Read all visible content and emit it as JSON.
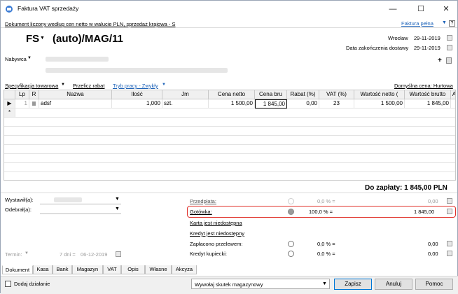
{
  "window": {
    "title": "Faktura VAT sprzedaży"
  },
  "info_bar": {
    "text": "Dokument liczony według cen netto w walucie PLN, sprzedaż krajowa - S",
    "link": "Faktura pełna"
  },
  "header": {
    "doc_type": "FS",
    "doc_number": "(auto)/MAG/11",
    "place": "Wrocław",
    "date": "29-11-2019",
    "delivery_label": "Data zakończenia dostawy",
    "delivery_date": "29-11-2019",
    "buyer_label": "Nabywca"
  },
  "toolbar": {
    "spec": "Specyfikacja towarowa",
    "recalc": "Przelicz rabat",
    "mode": "Tryb pracy - Zwykły",
    "default_price": "Domyślna cena: Hurtowa"
  },
  "grid": {
    "columns": [
      "Lp",
      "R",
      "Nazwa",
      "Ilość",
      "Jm",
      "Cena netto",
      "Cena bru",
      "Rabat (%)",
      "VAT (%)",
      "Wartość netto (",
      "Wartość brutto",
      "A"
    ],
    "rows": [
      {
        "lp": "1",
        "name": "adsf",
        "qty": "1,000",
        "unit": "szt.",
        "net": "1 500,00",
        "gross": "1 845,00",
        "discount": "0,00",
        "vat": "23",
        "net_value": "1 500,00",
        "gross_value": "1 845,00"
      }
    ]
  },
  "summary": {
    "to_pay": "Do zapłaty: 1 845,00 PLN"
  },
  "people": {
    "issued_by": "Wystawił(a):",
    "received_by": "Odebrał(a):"
  },
  "term": {
    "label": "Termin:",
    "days": "7 dni =",
    "date": "06-12-2019"
  },
  "payments": {
    "prepayment": {
      "label": "Przedpłata:",
      "pct": "0,0 % =",
      "amount": "0,00"
    },
    "cash": {
      "label": "Gotówka:",
      "pct": "100,0 % =",
      "amount": "1 845,00"
    },
    "card": "Karta jest niedostępna",
    "credit": "Kredyt jest niedostępny",
    "transfer": {
      "label": "Zapłacono przelewem:",
      "pct": "0,0 % =",
      "amount": "0,00"
    },
    "buyer_credit": {
      "label": "Kredyt kupiecki:",
      "pct": "0,0 % =",
      "amount": "0,00"
    }
  },
  "tabs": [
    "Dokument",
    "Kasa",
    "Bank",
    "Magazyn",
    "VAT",
    "Opis",
    "Własne",
    "Akcyza"
  ],
  "footer": {
    "add_action": "Dodaj działanie",
    "effect": "Wywołaj skutek magazynowy",
    "save": "Zapisz",
    "cancel": "Anuluj",
    "help": "Pomoc"
  },
  "colors": {
    "accent": "#1e63b8",
    "highlight": "#e0312a"
  }
}
